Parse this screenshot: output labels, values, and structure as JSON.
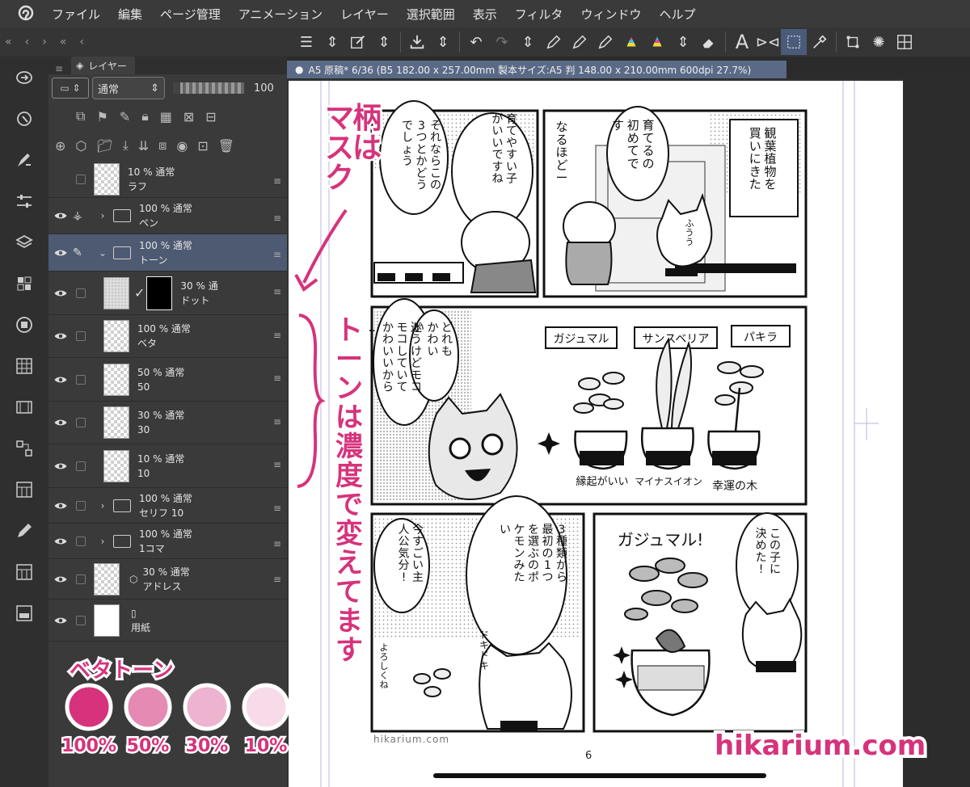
{
  "menu": {
    "items": [
      "ファイル",
      "編集",
      "ページ管理",
      "アニメーション",
      "レイヤー",
      "選択範囲",
      "表示",
      "フィルタ",
      "ウィンドウ",
      "ヘルプ"
    ]
  },
  "panel": {
    "tab_label": "レイヤー",
    "blend_mode": "通常",
    "opacity": "100"
  },
  "layers": [
    {
      "mode": "10 % 通常",
      "name": "ラフ",
      "visible": false,
      "type": "raster-3d"
    },
    {
      "mode": "100 % 通常",
      "name": "ペン",
      "visible": true,
      "type": "folder"
    },
    {
      "mode": "100 % 通常",
      "name": "トーン",
      "visible": true,
      "type": "folder-open",
      "selected": true
    },
    {
      "mode": "30 % 通",
      "name": "ドット",
      "visible": true,
      "type": "raster-mask"
    },
    {
      "mode": "100 % 通常",
      "name": "ベタ",
      "visible": true,
      "type": "raster"
    },
    {
      "mode": "50 % 通常",
      "name": "50",
      "visible": true,
      "type": "raster"
    },
    {
      "mode": "30 % 通常",
      "name": "30",
      "visible": true,
      "type": "raster"
    },
    {
      "mode": "10 % 通常",
      "name": "10",
      "visible": true,
      "type": "raster"
    },
    {
      "mode": "100 % 通常",
      "name": "セリフ 10",
      "visible": true,
      "type": "folder"
    },
    {
      "mode": "100 % 通常",
      "name": "1コマ",
      "visible": true,
      "type": "folder"
    },
    {
      "mode": "30 % 通常",
      "name": "アドレス",
      "visible": true,
      "type": "raster-3d"
    },
    {
      "mode": "",
      "name": "用紙",
      "visible": true,
      "type": "paper"
    }
  ],
  "document": {
    "tab_title": "A5 原稿* 6/36 (B5 182.00 x 257.00mm 製本サイズ:A5 判 148.00 x 210.00mm 600dpi 27.7%)",
    "page_number": "6",
    "watermark_small": "hikarium.com"
  },
  "annotations": {
    "vertical_1": "柄はマスク",
    "vertical_2": "トーンは濃度で変えてます",
    "beta_tone": "ベタトーン",
    "percents": [
      "100%",
      "50%",
      "30%",
      "10%"
    ],
    "watermark": "hikarium.com",
    "accent": "#d6337c"
  },
  "manga": {
    "p1_box": "観葉植物を買いにきた",
    "p1_bubble": "育てるの初めてです",
    "p1_sfx": "なるほどー",
    "p1_small": "ふうう",
    "p2_bubble1": "育てやすい子がいいですね",
    "p2_bubble2": "それならこの3つとかどうでしょう",
    "p3_bubble1": "どれもかわいい",
    "p3_bubble2": "迷うけどモコモコしていてかわいいから…",
    "plants": [
      "ガジュマル",
      "サンスベリア",
      "パキラ"
    ],
    "plant_notes": [
      "縁起がいい",
      "マイナスイオン",
      "幸運の木"
    ],
    "p4_bubble1": "今すごい主人公気分!",
    "p4_bubble2": "3種類から最初の1つを選ぶのポケモンみたい",
    "p4_sfx1": "ドキドキ",
    "p4_sfx2": "よろしくね",
    "p5_shout": "ガジュマル!",
    "p5_bubble": "この子に決めた!"
  }
}
